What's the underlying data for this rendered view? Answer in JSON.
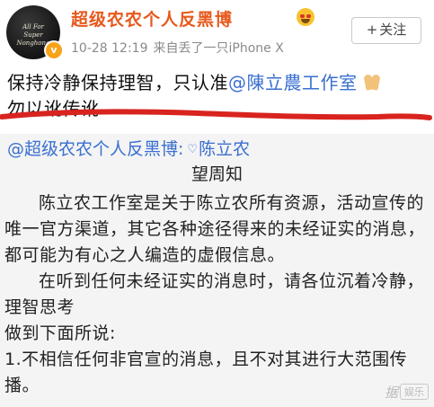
{
  "header": {
    "avatar_text": "All For\nSuper Nonghong",
    "vip_badge": "v",
    "username": "超级农农个人反黑博",
    "username_emoji": "grinning-face-icon",
    "meta_time": "10-28 12:19",
    "meta_device": "来自丢了一只iPhone X",
    "follow_label": "关注",
    "follow_icon": "+"
  },
  "post": {
    "text_before": "保持冷静保持理智，只认准",
    "mention": "@陳立農工作室",
    "emoji": "pray-icon",
    "text_after": "勿以讹传讹",
    "annotation_color": "#d8231f"
  },
  "repost": {
    "author": "@超级农农个人反黑博",
    "separator": ":",
    "mention": "陈立农",
    "title": "望周知",
    "paragraphs": [
      "陈立农工作室是关于陈立农所有资源，活动宣传的唯一官方渠道，其它各种途径得来的未经证实的消息，都可能为有心之人编造的虚假信息。",
      "在听到任何未经证实的消息时，请各位沉着冷静，理智思考",
      "做到下面所说:",
      "1.不相信任何非官宣的消息，且不对其进行大范围传播。"
    ]
  },
  "watermark": {
    "main": "据",
    "sub": "娱乐"
  },
  "colors": {
    "username": "#e8581c",
    "link": "#3a6fd0",
    "repost_bg": "#f4f4f4",
    "badge": "#f7a31a"
  }
}
